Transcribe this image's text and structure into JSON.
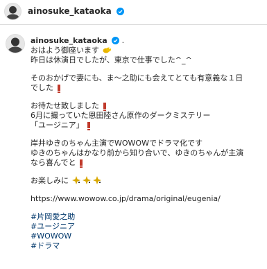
{
  "header": {
    "username": "ainosuke_kataoka"
  },
  "post": {
    "username": "ainosuke_kataoka",
    "username_suffix": ".",
    "lines": [
      "おはよう御座います",
      "昨日は休演日でしたが、東京で仕事でした^_^",
      "そのおかげで妻にも、ま〜之助にも会えてとても有意義な１日",
      "でした",
      "お待たせ致しました",
      "6月に撮っていた恩田陸さん原作のダークミステリー",
      "「ユージニア」",
      "岸井ゆきのちゃん主演でWOWOWでドラマ化です",
      "ゆきのちゃんはかなり前から知り合いで、ゆきのちゃんが主演",
      "なら喜んでと",
      "お楽しみに",
      "https://www.wowow.co.jp/drama/original/eugenia/"
    ],
    "hashtags": [
      "#片岡愛之助",
      "#ユージニア",
      "#WOWOW",
      "#ドラマ"
    ]
  },
  "colors": {
    "hashtag": "#00376b",
    "verified": "#0095f6",
    "exclamation": "#c0392b"
  },
  "icons": [
    "verified-badge-icon",
    "sun-emoji-icon",
    "exclamation-emoji-icon",
    "sparkle-emoji-icon"
  ]
}
